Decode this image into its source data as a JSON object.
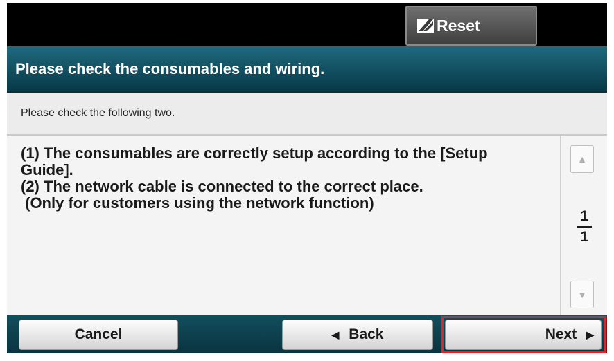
{
  "header": {
    "reset_label": "Reset",
    "reset_icon": "reset-icon"
  },
  "title": "Please check the consumables and wiring.",
  "subtitle": "Please check the following two.",
  "body": {
    "lines": [
      "(1) The consumables are correctly setup according to the [Setup",
      "Guide].",
      "(2) The network cable is connected to the correct place.",
      " (Only for customers using the network function)"
    ]
  },
  "pager": {
    "current": "1",
    "total": "1",
    "up_icon": "scroll-up-icon",
    "down_icon": "scroll-down-icon"
  },
  "footer": {
    "cancel_label": "Cancel",
    "back_label": "Back",
    "next_label": "Next"
  },
  "colors": {
    "title_bar": "#0f4f60",
    "bottom_bar": "#124e5d",
    "highlight": "#d9252c"
  }
}
